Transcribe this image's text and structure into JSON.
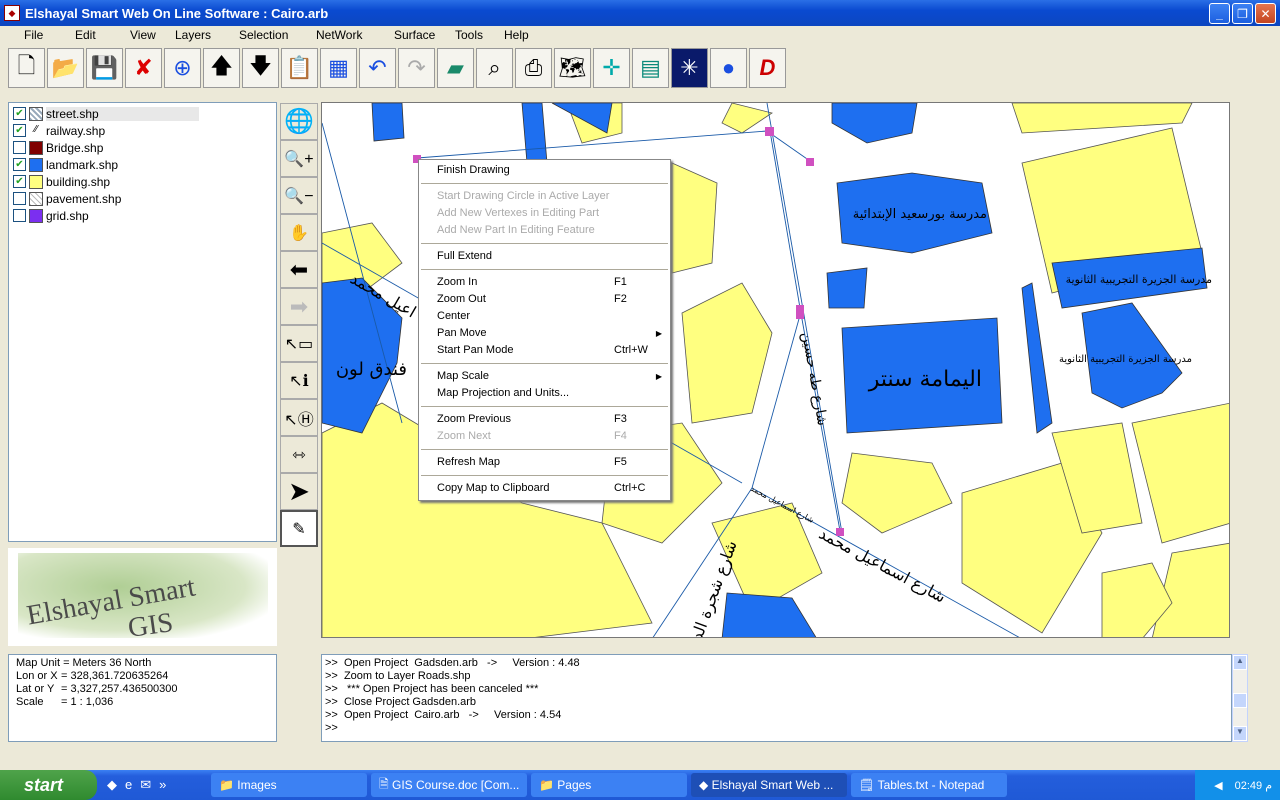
{
  "window": {
    "title": "Elshayal Smart Web On Line Software : Cairo.arb"
  },
  "menu": [
    "File",
    "Edit",
    "View",
    "Layers",
    "Selection",
    "NetWork",
    "Surface",
    "Tools",
    "Help"
  ],
  "layers": [
    {
      "name": "street.shp",
      "checked": true,
      "symbol": "hatch"
    },
    {
      "name": "railway.shp",
      "checked": true,
      "symbol": "line"
    },
    {
      "name": "Bridge.shp",
      "checked": false,
      "symbol": "#800000"
    },
    {
      "name": "landmark.shp",
      "checked": true,
      "symbol": "#1e6ff0"
    },
    {
      "name": "building.shp",
      "checked": true,
      "symbol": "#ffff80"
    },
    {
      "name": "pavement.shp",
      "checked": false,
      "symbol": "cross"
    },
    {
      "name": "grid.shp",
      "checked": false,
      "symbol": "#7b2ff0"
    }
  ],
  "logo": {
    "line1": "Elshayal Smart",
    "line2": "GIS"
  },
  "coords": {
    "unit": "Map Unit = Meters 36 North",
    "x_label": "Lon or X",
    "x_value": "= 328,361.720635264",
    "y_label": "Lat or Y",
    "y_value": "= 3,327,257.436500300",
    "scale_label": "Scale",
    "scale_value": "= 1 : 1,036"
  },
  "context_menu": [
    {
      "label": "Finish Drawing",
      "shortcut": "",
      "disabled": false
    },
    {
      "sep": true
    },
    {
      "label": "Start Drawing Circle in Active Layer",
      "shortcut": "",
      "disabled": true
    },
    {
      "label": "Add New Vertexes in Editing Part",
      "shortcut": "",
      "disabled": true
    },
    {
      "label": "Add New Part In Editing Feature",
      "shortcut": "",
      "disabled": true
    },
    {
      "sep": true
    },
    {
      "label": "Full Extend",
      "shortcut": "",
      "disabled": false
    },
    {
      "sep": true
    },
    {
      "label": "Zoom In",
      "shortcut": "F1",
      "disabled": false
    },
    {
      "label": "Zoom Out",
      "shortcut": "F2",
      "disabled": false
    },
    {
      "label": "Center",
      "shortcut": "",
      "disabled": false
    },
    {
      "label": "Pan Move",
      "shortcut": "",
      "disabled": false,
      "submenu": true
    },
    {
      "label": "Start Pan Mode",
      "shortcut": "Ctrl+W",
      "disabled": false
    },
    {
      "sep": true
    },
    {
      "label": "Map Scale",
      "shortcut": "",
      "disabled": false,
      "submenu": true
    },
    {
      "label": "Map Projection and Units...",
      "shortcut": "",
      "disabled": false
    },
    {
      "sep": true
    },
    {
      "label": "Zoom Previous",
      "shortcut": "F3",
      "disabled": false
    },
    {
      "label": "Zoom Next",
      "shortcut": "F4",
      "disabled": true
    },
    {
      "sep": true
    },
    {
      "label": "Refresh Map",
      "shortcut": "F5",
      "disabled": false
    },
    {
      "sep": true
    },
    {
      "label": "Copy Map to Clipboard",
      "shortcut": "Ctrl+C",
      "disabled": false
    }
  ],
  "map_labels": {
    "school1": "مدرسة بورسعيد الإبتدائية",
    "school2": "مدرسة الجزيرة التجريبية الثانوية",
    "school3": "مدرسة الجزيرة التجريبية الثانوية",
    "yamama": "اليمامة سنتر",
    "hotel": "فندق لون",
    "street1": "شارع اسماعيل محمد",
    "street2": "شارع طه حسين",
    "street3": "شارع شجرة الدر",
    "street4": "اعيل محمد",
    "street5": "شارع اسماعيل محمد"
  },
  "log": [
    ">>  Open Project  Gadsden.arb   ->     Version : 4.48",
    ">>  Zoom to Layer Roads.shp",
    ">>   *** Open Project has been canceled ***",
    ">>  Close Project Gadsden.arb",
    ">>  Open Project  Cairo.arb   ->     Version : 4.54",
    ">>"
  ],
  "taskbar": {
    "start": "start",
    "tasks": [
      "Images",
      "GIS Course.doc [Com...",
      "Pages",
      "Elshayal Smart Web ...",
      "Tables.txt - Notepad"
    ],
    "clock": "02:49 م"
  }
}
